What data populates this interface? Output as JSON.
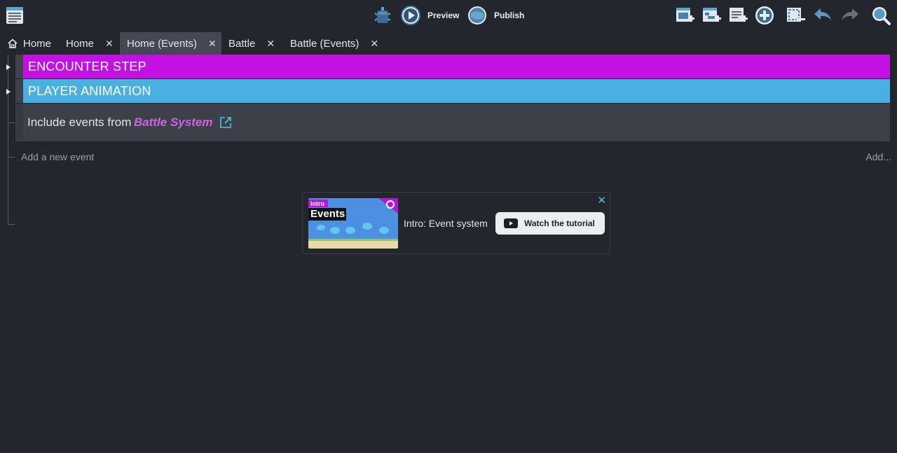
{
  "toolbar": {
    "preview_label": "Preview",
    "publish_label": "Publish"
  },
  "tabs": [
    {
      "label": "Home",
      "has_close": false
    },
    {
      "label": "Home",
      "has_close": true
    },
    {
      "label": "Home (Events)",
      "has_close": true,
      "active": true
    },
    {
      "label": "Battle",
      "has_close": true
    },
    {
      "label": "Battle (Events)",
      "has_close": true
    }
  ],
  "close_glyph": "✕",
  "events": {
    "groups": [
      {
        "title": "ENCOUNTER STEP",
        "color": "#c211e2"
      },
      {
        "title": "PLAYER ANIMATION",
        "color": "#4ab0e4"
      }
    ],
    "include": {
      "text": "Include events from",
      "link": "Battle System"
    },
    "add_event": "Add a new event",
    "add_menu": "Add..."
  },
  "tutorial": {
    "thumb_tag": "Intro",
    "thumb_title": "Events",
    "title": "Intro: Event system",
    "button": "Watch the tutorial"
  },
  "colors": {
    "background": "#24262e",
    "active_tab": "#454852",
    "link": "#cc63e2",
    "accent": "#4fc3e6"
  }
}
